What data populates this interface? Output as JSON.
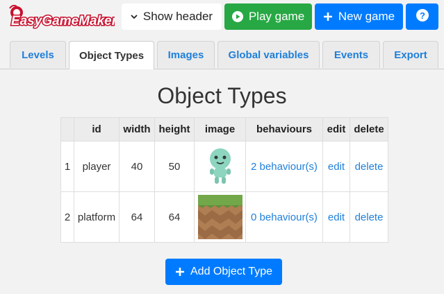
{
  "header": {
    "logo_text": "EasyGameMaker",
    "show_header_label": "Show header",
    "play_game_label": "Play game",
    "new_game_label": "New game",
    "help_label": "?"
  },
  "tabs": [
    {
      "label": "Levels"
    },
    {
      "label": "Object Types",
      "active": true
    },
    {
      "label": "Images"
    },
    {
      "label": "Global variables"
    },
    {
      "label": "Events"
    },
    {
      "label": "Export"
    }
  ],
  "main": {
    "title": "Object Types",
    "columns": [
      "",
      "id",
      "width",
      "height",
      "image",
      "behaviours",
      "edit",
      "delete"
    ],
    "rows": [
      {
        "index": "1",
        "id": "player",
        "width": "40",
        "height": "50",
        "image": "green-alien-sprite",
        "behaviours": "2 behaviour(s)",
        "edit": "edit",
        "delete": "delete"
      },
      {
        "index": "2",
        "id": "platform",
        "width": "64",
        "height": "64",
        "image": "grass-dirt-tile",
        "behaviours": "0 behaviour(s)",
        "edit": "edit",
        "delete": "delete"
      }
    ],
    "add_button_label": "Add Object Type"
  },
  "colors": {
    "primary": "#007bff",
    "success": "#27a844",
    "link": "#1f7fd9",
    "background": "#f2f2f2"
  },
  "icons": [
    "chevron-down-icon",
    "play-circle-icon",
    "plus-icon",
    "question-icon"
  ]
}
